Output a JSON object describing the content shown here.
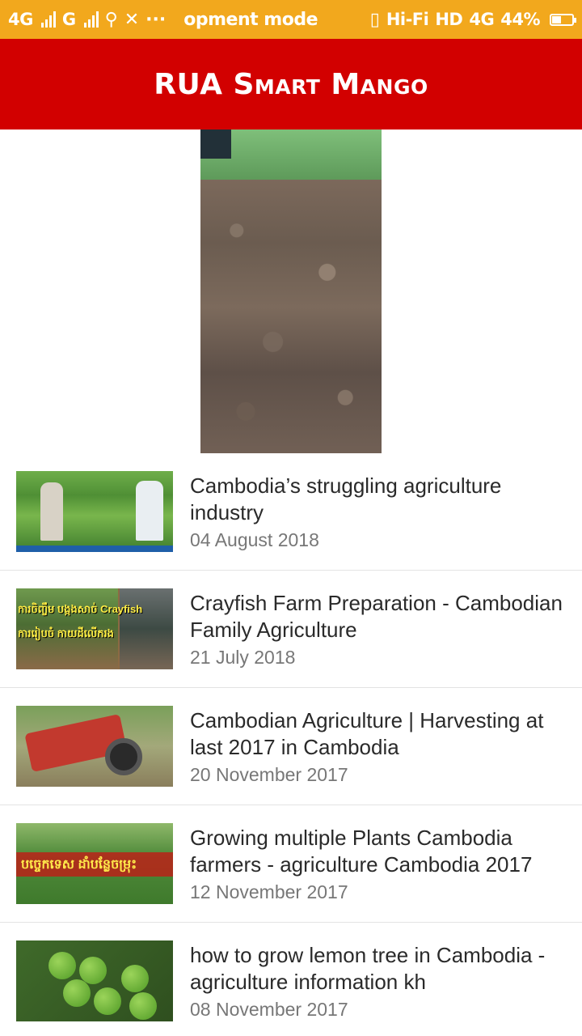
{
  "status_bar": {
    "left_network_1": "4G",
    "left_network_2": "G",
    "mode_text": "opment mode",
    "right_audio": "Hi-Fi",
    "right_hd": "HD",
    "right_network": "4G",
    "battery_percent": "44%",
    "battery_level": 0.44,
    "background_color": "#f2a81d"
  },
  "app_bar": {
    "title": "RUA Smart Mango",
    "background_color": "#d20000"
  },
  "video": {
    "icon": "video-player"
  },
  "articles": [
    {
      "title": "Cambodia’s struggling agriculture industry",
      "date": "04 August 2018"
    },
    {
      "title": "Crayfish Farm Preparation - Cambodian Family Agriculture",
      "date": "21 July 2018",
      "thumb_caption_1": "ការចិញ្ចឹម បង្កងសាច់ Crayfish",
      "thumb_caption_2": "ការរៀបចំ កាយដីលើករង"
    },
    {
      "title": "Cambodian Agriculture | Harvesting at last 2017 in Cambodia",
      "date": "20 November 2017"
    },
    {
      "title": "Growing multiple Plants Cambodia farmers - agriculture Cambodia 2017",
      "date": "12 November 2017",
      "thumb_caption": "បច្ចេកទេស ដាំបន្លែចម្រុះ"
    },
    {
      "title": "how to grow lemon tree in Cambodia - agriculture information kh",
      "date": "08 November 2017"
    }
  ]
}
